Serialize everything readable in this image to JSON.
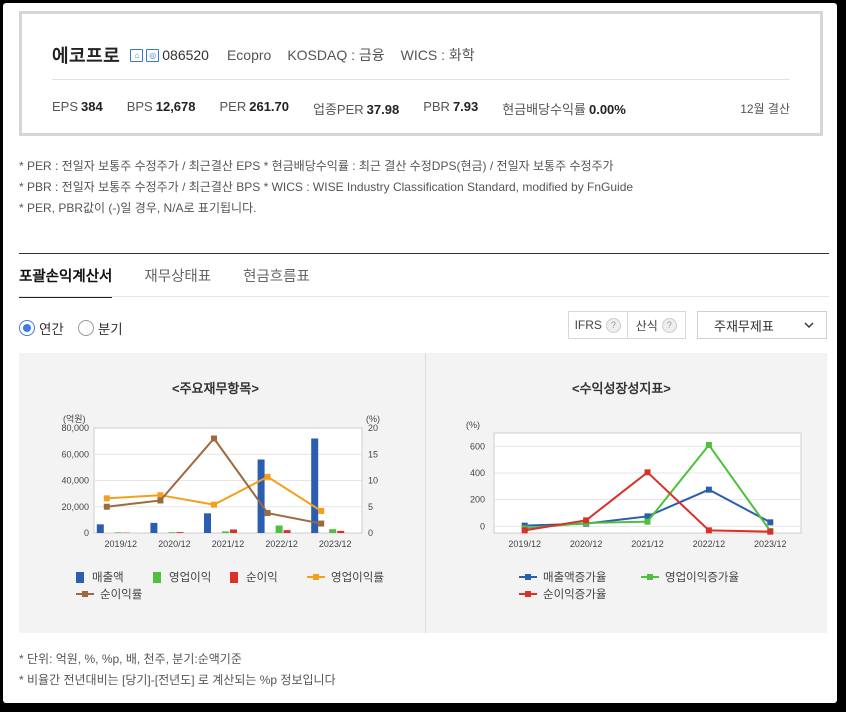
{
  "summary": {
    "company": "에코프로",
    "code": "086520",
    "english_name": "Ecopro",
    "market": "KOSDAQ : 금융",
    "wics": "WICS : 화학",
    "metrics": [
      {
        "label": "EPS",
        "value": "384"
      },
      {
        "label": "BPS",
        "value": "12,678"
      },
      {
        "label": "PER",
        "value": "261.70"
      },
      {
        "label": "업종PER",
        "value": "37.98"
      },
      {
        "label": "PBR",
        "value": "7.93"
      },
      {
        "label": "현금배당수익률",
        "value": "0.00%"
      }
    ],
    "settlement": "12월 결산"
  },
  "notes": [
    "* PER : 전일자 보통주 수정주가 / 최근결산 EPS * 현금배당수익률 : 최근 결산 수정DPS(현금) / 전일자 보통주 수정주가",
    "* PBR : 전일자 보통주 수정주가 / 최근결산 BPS * WICS : WISE Industry Classification Standard, modified by FnGuide",
    "* PER, PBR값이 (-)일 경우, N/A로 표기됩니다."
  ],
  "tabs": [
    "포괄손익계산서",
    "재무상태표",
    "현금흐름표"
  ],
  "period": {
    "annual": "연간",
    "quarter": "분기"
  },
  "options": {
    "ifrs": "IFRS",
    "calc": "산식",
    "select": "주재무제표"
  },
  "colors": {
    "sales": "#2b5db0",
    "op_profit": "#4ec03c",
    "net_profit": "#d9312a",
    "op_margin": "#f5a01a",
    "net_margin": "#9c6a3f",
    "accent": "#3d7be0"
  },
  "chart_data": [
    {
      "type": "bar",
      "title": "<주요재무항목>",
      "ylabel": "(억원)",
      "y2label": "(%)",
      "categories": [
        "2019/12",
        "2020/12",
        "2021/12",
        "2022/12",
        "2023/12"
      ],
      "ylim": [
        0,
        80000
      ],
      "yticks": [
        "80,000",
        "60,000",
        "40,000",
        "20,000",
        "0"
      ],
      "y2lim": [
        0,
        20
      ],
      "y2ticks": [
        "20",
        "15",
        "10",
        "5",
        "0"
      ],
      "series": [
        {
          "name": "매출액",
          "kind": "bar",
          "axis": "left",
          "values": [
            6600,
            7700,
            15000,
            56000,
            72000
          ]
        },
        {
          "name": "영업이익",
          "kind": "bar",
          "axis": "left",
          "values": [
            500,
            600,
            1200,
            5700,
            2900
          ]
        },
        {
          "name": "순이익",
          "kind": "bar",
          "axis": "left",
          "values": [
            300,
            700,
            2700,
            2200,
            1600
          ]
        },
        {
          "name": "영업이익률",
          "kind": "line",
          "axis": "right",
          "values": [
            6.6,
            7.2,
            5.4,
            10.7,
            4.2
          ]
        },
        {
          "name": "순이익률",
          "kind": "line",
          "axis": "right",
          "values": [
            5.0,
            6.2,
            18.0,
            3.8,
            1.8
          ]
        }
      ],
      "legend": "bottom"
    },
    {
      "type": "line",
      "title": "<수익성장성지표>",
      "ylabel": "(%)",
      "categories": [
        "2019/12",
        "2020/12",
        "2021/12",
        "2022/12",
        "2023/12"
      ],
      "ylim": [
        0,
        700
      ],
      "yticks": [
        "600",
        "400",
        "200",
        "0"
      ],
      "series": [
        {
          "name": "매출액증가율",
          "values": [
            5,
            20,
            75,
            275,
            30
          ]
        },
        {
          "name": "영업이익증가율",
          "values": [
            -15,
            25,
            35,
            610,
            -35
          ]
        },
        {
          "name": "순이익증가율",
          "values": [
            -30,
            45,
            405,
            -30,
            -40
          ]
        }
      ],
      "legend": "bottom"
    }
  ],
  "footnotes": [
    "* 단위: 억원, %, %p, 배, 천주, 분기:순액기준",
    "* 비율간 전년대비는 [당기]-[전년도] 로 계산되는 %p 정보입니다"
  ]
}
